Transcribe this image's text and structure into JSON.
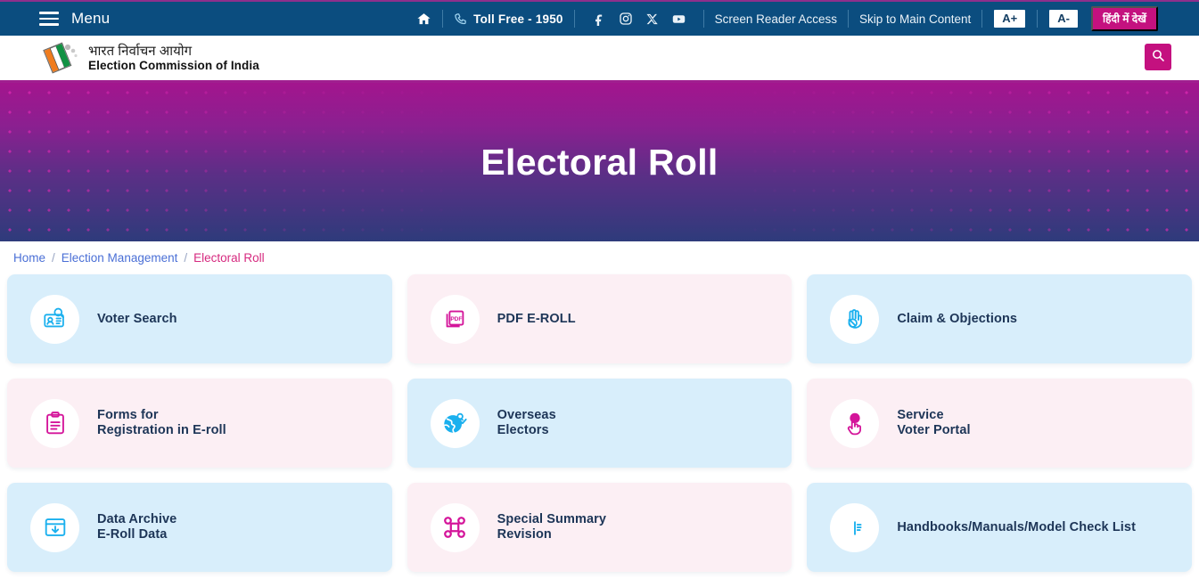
{
  "topbar": {
    "menu_label": "Menu",
    "menu_icon": "hamburger-icon",
    "home_icon": "home-icon",
    "phone_icon": "phone-icon",
    "toll_free": "Toll Free - 1950",
    "social": [
      {
        "name": "facebook-icon",
        "label": "Facebook"
      },
      {
        "name": "instagram-icon",
        "label": "Instagram"
      },
      {
        "name": "x-twitter-icon",
        "label": "X"
      },
      {
        "name": "youtube-icon",
        "label": "YouTube"
      }
    ],
    "screen_reader": "Screen Reader Access",
    "skip_main": "Skip to Main Content",
    "font_increase": "A+",
    "font_decrease": "A-",
    "language_button": "हिंदी में देखें"
  },
  "header": {
    "logo_icon": "eci-logo-icon",
    "title_hindi": "भारत निर्वाचन आयोग",
    "title_english": "Election Commission of India",
    "search_icon": "search-icon"
  },
  "hero": {
    "title": "Electoral Roll",
    "gradient_top": "#a3158e",
    "gradient_bottom": "#2e3b7b",
    "dot_color": "#e12ab4"
  },
  "breadcrumb": {
    "items": [
      {
        "label": "Home",
        "current": false
      },
      {
        "label": "Election Management",
        "current": false
      },
      {
        "label": "Electoral Roll",
        "current": true
      }
    ],
    "separator": "/",
    "link_color": "#4a6fd6",
    "current_color": "#d6297f"
  },
  "cards": [
    {
      "label_line1": "Voter Search",
      "label_line2": "",
      "theme": "blue",
      "icon": "voter-id-search-icon",
      "icon_color": "#1bb0ee"
    },
    {
      "label_line1": "PDF E-ROLL",
      "label_line2": "",
      "theme": "pink",
      "icon": "pdf-file-icon",
      "icon_color": "#d4159a"
    },
    {
      "label_line1": "Claim & Objections",
      "label_line2": "",
      "theme": "blue",
      "icon": "raised-hand-icon",
      "icon_color": "#1bb0ee"
    },
    {
      "label_line1": "Forms for",
      "label_line2": "Registration in E-roll",
      "theme": "pink",
      "icon": "clipboard-form-icon",
      "icon_color": "#d4159a"
    },
    {
      "label_line1": "Overseas",
      "label_line2": "Electors",
      "theme": "blue",
      "icon": "globe-user-check-icon",
      "icon_color": "#1bb0ee"
    },
    {
      "label_line1": "Service",
      "label_line2": "Voter Portal",
      "theme": "pink",
      "icon": "hand-click-icon",
      "icon_color": "#d4159a"
    },
    {
      "label_line1": "Data Archive",
      "label_line2": "E-Roll Data",
      "theme": "blue",
      "icon": "archive-download-icon",
      "icon_color": "#1bb0ee"
    },
    {
      "label_line1": "Special Summary",
      "label_line2": "Revision",
      "theme": "pink",
      "icon": "command-loop-icon",
      "icon_color": "#d4159a"
    },
    {
      "label_line1": "Handbooks/Manuals/Model Check List",
      "label_line2": "",
      "theme": "blue",
      "icon": "open-book-icon",
      "icon_color": "#1bb0ee"
    }
  ],
  "colors": {
    "topbar_bg": "#0b4d7f",
    "accent_magenta": "#c4117f",
    "card_blue": "#d8eefb",
    "card_pink": "#fceff4",
    "text_navy": "#1d3557"
  }
}
